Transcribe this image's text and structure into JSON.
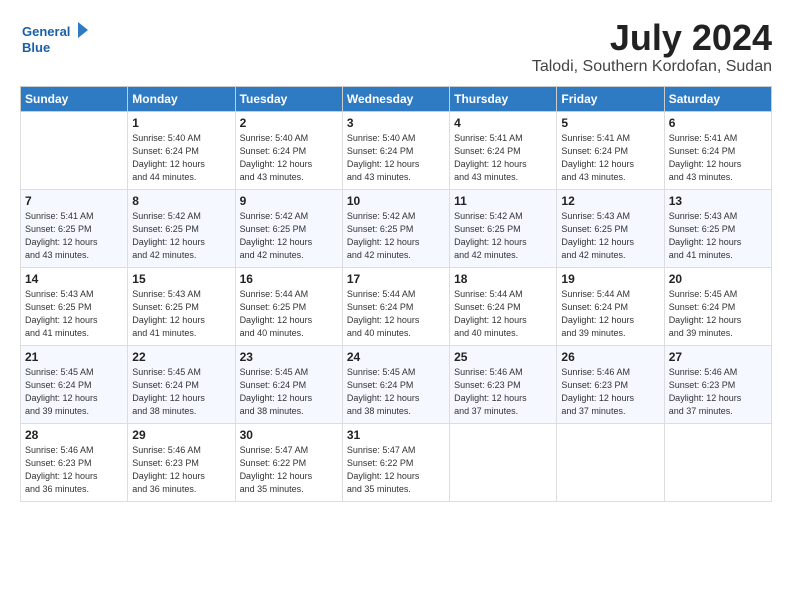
{
  "header": {
    "logo_line1": "General",
    "logo_line2": "Blue",
    "title": "July 2024",
    "location": "Talodi, Southern Kordofan, Sudan"
  },
  "weekdays": [
    "Sunday",
    "Monday",
    "Tuesday",
    "Wednesday",
    "Thursday",
    "Friday",
    "Saturday"
  ],
  "weeks": [
    [
      {
        "day": "",
        "info": ""
      },
      {
        "day": "1",
        "info": "Sunrise: 5:40 AM\nSunset: 6:24 PM\nDaylight: 12 hours\nand 44 minutes."
      },
      {
        "day": "2",
        "info": "Sunrise: 5:40 AM\nSunset: 6:24 PM\nDaylight: 12 hours\nand 43 minutes."
      },
      {
        "day": "3",
        "info": "Sunrise: 5:40 AM\nSunset: 6:24 PM\nDaylight: 12 hours\nand 43 minutes."
      },
      {
        "day": "4",
        "info": "Sunrise: 5:41 AM\nSunset: 6:24 PM\nDaylight: 12 hours\nand 43 minutes."
      },
      {
        "day": "5",
        "info": "Sunrise: 5:41 AM\nSunset: 6:24 PM\nDaylight: 12 hours\nand 43 minutes."
      },
      {
        "day": "6",
        "info": "Sunrise: 5:41 AM\nSunset: 6:24 PM\nDaylight: 12 hours\nand 43 minutes."
      }
    ],
    [
      {
        "day": "7",
        "info": "Sunrise: 5:41 AM\nSunset: 6:25 PM\nDaylight: 12 hours\nand 43 minutes."
      },
      {
        "day": "8",
        "info": "Sunrise: 5:42 AM\nSunset: 6:25 PM\nDaylight: 12 hours\nand 42 minutes."
      },
      {
        "day": "9",
        "info": "Sunrise: 5:42 AM\nSunset: 6:25 PM\nDaylight: 12 hours\nand 42 minutes."
      },
      {
        "day": "10",
        "info": "Sunrise: 5:42 AM\nSunset: 6:25 PM\nDaylight: 12 hours\nand 42 minutes."
      },
      {
        "day": "11",
        "info": "Sunrise: 5:42 AM\nSunset: 6:25 PM\nDaylight: 12 hours\nand 42 minutes."
      },
      {
        "day": "12",
        "info": "Sunrise: 5:43 AM\nSunset: 6:25 PM\nDaylight: 12 hours\nand 42 minutes."
      },
      {
        "day": "13",
        "info": "Sunrise: 5:43 AM\nSunset: 6:25 PM\nDaylight: 12 hours\nand 41 minutes."
      }
    ],
    [
      {
        "day": "14",
        "info": "Sunrise: 5:43 AM\nSunset: 6:25 PM\nDaylight: 12 hours\nand 41 minutes."
      },
      {
        "day": "15",
        "info": "Sunrise: 5:43 AM\nSunset: 6:25 PM\nDaylight: 12 hours\nand 41 minutes."
      },
      {
        "day": "16",
        "info": "Sunrise: 5:44 AM\nSunset: 6:25 PM\nDaylight: 12 hours\nand 40 minutes."
      },
      {
        "day": "17",
        "info": "Sunrise: 5:44 AM\nSunset: 6:24 PM\nDaylight: 12 hours\nand 40 minutes."
      },
      {
        "day": "18",
        "info": "Sunrise: 5:44 AM\nSunset: 6:24 PM\nDaylight: 12 hours\nand 40 minutes."
      },
      {
        "day": "19",
        "info": "Sunrise: 5:44 AM\nSunset: 6:24 PM\nDaylight: 12 hours\nand 39 minutes."
      },
      {
        "day": "20",
        "info": "Sunrise: 5:45 AM\nSunset: 6:24 PM\nDaylight: 12 hours\nand 39 minutes."
      }
    ],
    [
      {
        "day": "21",
        "info": "Sunrise: 5:45 AM\nSunset: 6:24 PM\nDaylight: 12 hours\nand 39 minutes."
      },
      {
        "day": "22",
        "info": "Sunrise: 5:45 AM\nSunset: 6:24 PM\nDaylight: 12 hours\nand 38 minutes."
      },
      {
        "day": "23",
        "info": "Sunrise: 5:45 AM\nSunset: 6:24 PM\nDaylight: 12 hours\nand 38 minutes."
      },
      {
        "day": "24",
        "info": "Sunrise: 5:45 AM\nSunset: 6:24 PM\nDaylight: 12 hours\nand 38 minutes."
      },
      {
        "day": "25",
        "info": "Sunrise: 5:46 AM\nSunset: 6:23 PM\nDaylight: 12 hours\nand 37 minutes."
      },
      {
        "day": "26",
        "info": "Sunrise: 5:46 AM\nSunset: 6:23 PM\nDaylight: 12 hours\nand 37 minutes."
      },
      {
        "day": "27",
        "info": "Sunrise: 5:46 AM\nSunset: 6:23 PM\nDaylight: 12 hours\nand 37 minutes."
      }
    ],
    [
      {
        "day": "28",
        "info": "Sunrise: 5:46 AM\nSunset: 6:23 PM\nDaylight: 12 hours\nand 36 minutes."
      },
      {
        "day": "29",
        "info": "Sunrise: 5:46 AM\nSunset: 6:23 PM\nDaylight: 12 hours\nand 36 minutes."
      },
      {
        "day": "30",
        "info": "Sunrise: 5:47 AM\nSunset: 6:22 PM\nDaylight: 12 hours\nand 35 minutes."
      },
      {
        "day": "31",
        "info": "Sunrise: 5:47 AM\nSunset: 6:22 PM\nDaylight: 12 hours\nand 35 minutes."
      },
      {
        "day": "",
        "info": ""
      },
      {
        "day": "",
        "info": ""
      },
      {
        "day": "",
        "info": ""
      }
    ]
  ]
}
